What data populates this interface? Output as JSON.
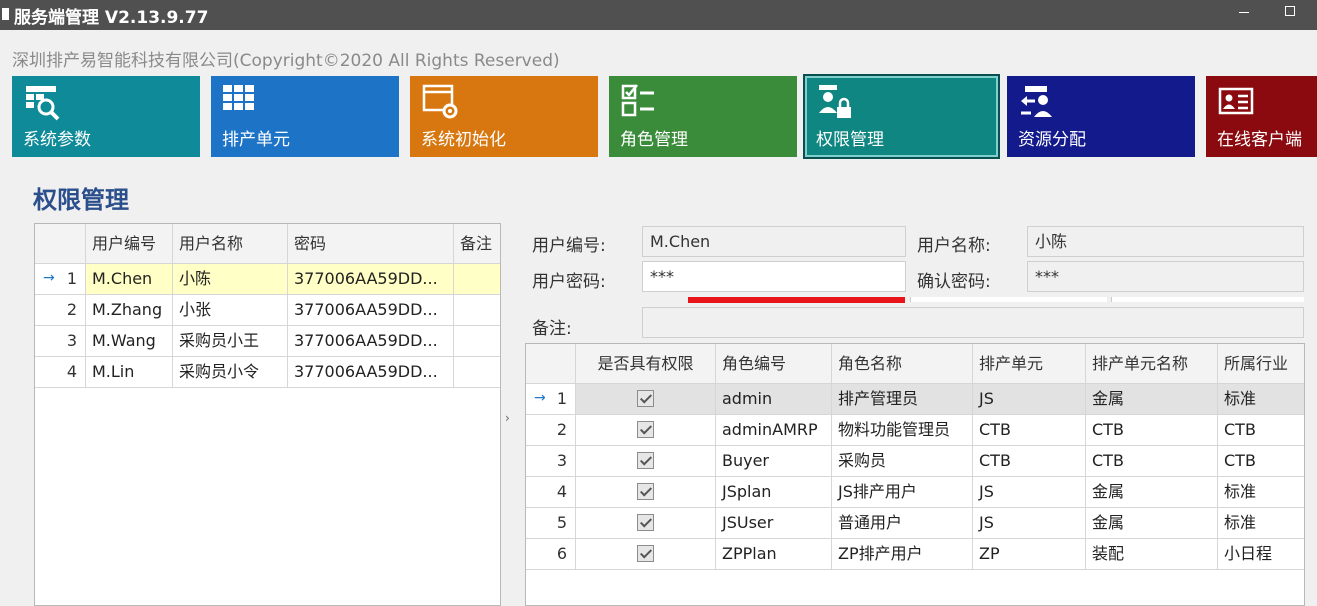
{
  "window": {
    "title": "服务端管理 V2.13.9.77"
  },
  "copyright": "深圳排产易智能科技有限公司(Copyright©2020 All Rights Reserved)",
  "tiles": [
    {
      "label": "系统参数",
      "color": "#0e8a99",
      "icon": "table-search-icon"
    },
    {
      "label": "排产单元",
      "color": "#1d74c7",
      "icon": "grid-icon"
    },
    {
      "label": "系统初始化",
      "color": "#d87710",
      "icon": "window-gear-icon"
    },
    {
      "label": "角色管理",
      "color": "#3a8c3a",
      "icon": "checklist-icon"
    },
    {
      "label": "权限管理",
      "color": "#0f8681",
      "icon": "user-lock-icon"
    },
    {
      "label": "资源分配",
      "color": "#131a8c",
      "icon": "resource-transfer-icon"
    },
    {
      "label": "在线客户端",
      "color": "#8a0a0f",
      "icon": "id-card-icon"
    }
  ],
  "section_title": "权限管理",
  "user_grid": {
    "columns": [
      "用户编号",
      "用户名称",
      "密码",
      "备注"
    ],
    "rows": [
      {
        "no": "1",
        "id": "M.Chen",
        "name": "小陈",
        "password": "377006AA59DD...",
        "note": ""
      },
      {
        "no": "2",
        "id": "M.Zhang",
        "name": "小张",
        "password": "377006AA59DD...",
        "note": ""
      },
      {
        "no": "3",
        "id": "M.Wang",
        "name": "采购员小王",
        "password": "377006AA59DD...",
        "note": ""
      },
      {
        "no": "4",
        "id": "M.Lin",
        "name": "采购员小令",
        "password": "377006AA59DD...",
        "note": ""
      }
    ],
    "selected_arrow": "→"
  },
  "form": {
    "user_id_label": "用户编号:",
    "user_id": "M.Chen",
    "user_name_label": "用户名称:",
    "user_name": "小陈",
    "password_label": "用户密码:",
    "password": "***",
    "confirm_label": "确认密码:",
    "confirm": "***",
    "note_label": "备注:",
    "note": ""
  },
  "splitter_glyph": "›",
  "role_grid": {
    "columns": [
      "是否具有权限",
      "角色编号",
      "角色名称",
      "排产单元",
      "排产单元名称",
      "所属行业"
    ],
    "rows": [
      {
        "no": "1",
        "checked": true,
        "code": "admin",
        "name": "排产管理员",
        "unit": "JS",
        "unit_name": "金属",
        "industry": "标准"
      },
      {
        "no": "2",
        "checked": true,
        "code": "adminAMRP",
        "name": "物料功能管理员",
        "unit": "CTB",
        "unit_name": "CTB",
        "industry": "CTB"
      },
      {
        "no": "3",
        "checked": true,
        "code": "Buyer",
        "name": "采购员",
        "unit": "CTB",
        "unit_name": "CTB",
        "industry": "CTB"
      },
      {
        "no": "4",
        "checked": true,
        "code": "JSplan",
        "name": "JS排产用户",
        "unit": "JS",
        "unit_name": "金属",
        "industry": "标准"
      },
      {
        "no": "5",
        "checked": true,
        "code": "JSUser",
        "name": "普通用户",
        "unit": "JS",
        "unit_name": "金属",
        "industry": "标准"
      },
      {
        "no": "6",
        "checked": true,
        "code": "ZPPlan",
        "name": "ZP排产用户",
        "unit": "ZP",
        "unit_name": "装配",
        "industry": "小日程"
      }
    ],
    "selected_arrow": "→"
  }
}
